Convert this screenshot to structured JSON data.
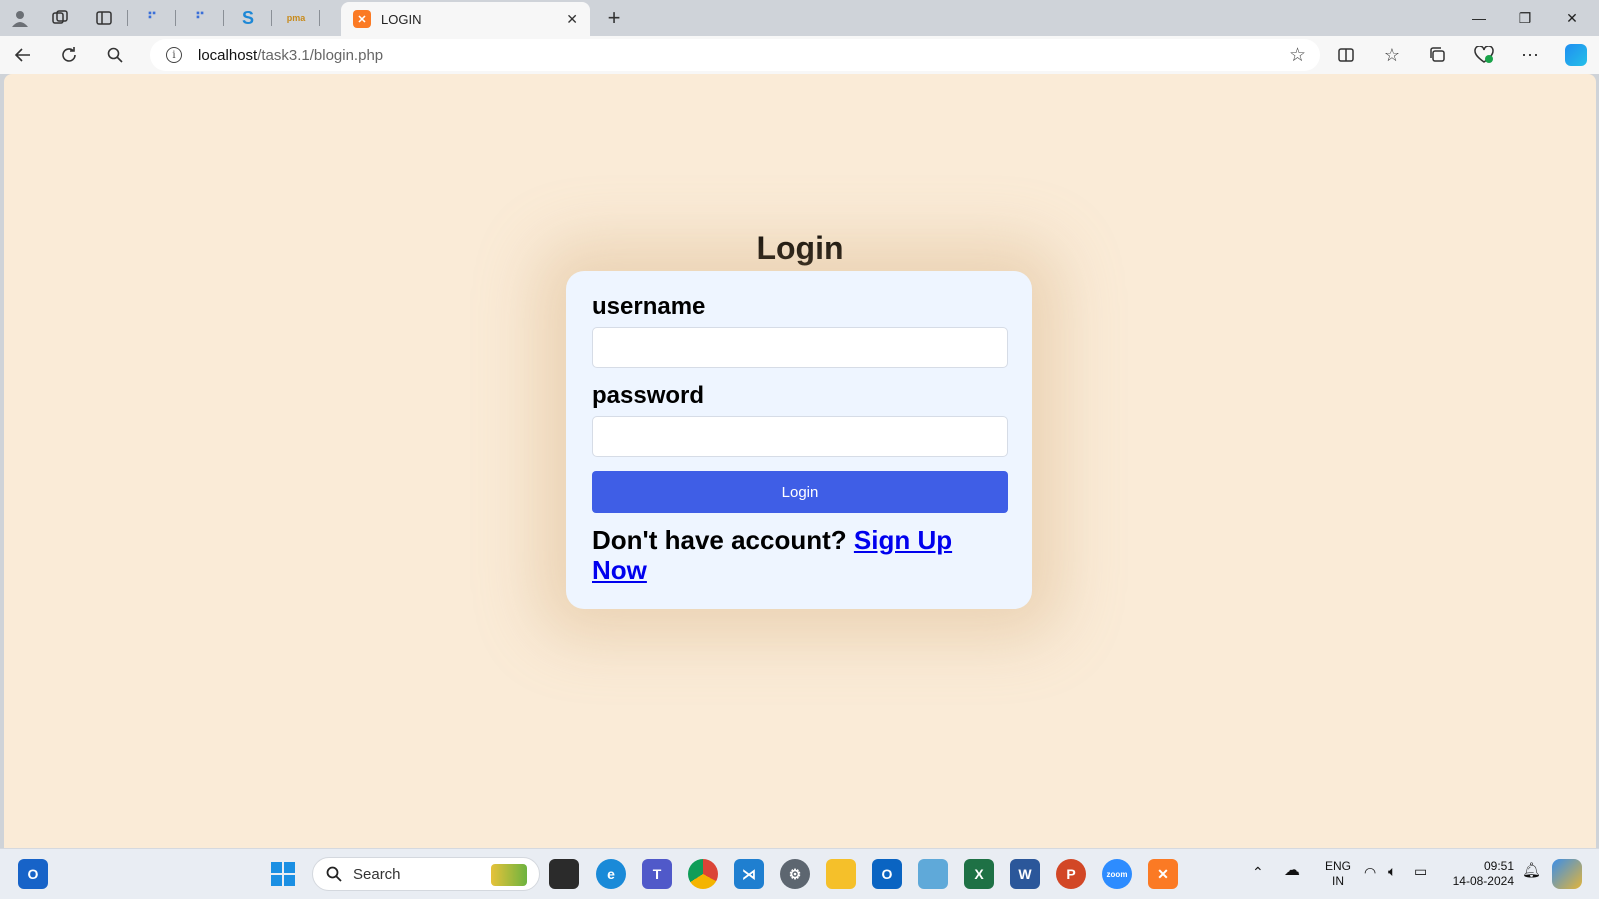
{
  "browser": {
    "tab": {
      "title": "LOGIN",
      "favicon": "xampp-icon"
    },
    "pinned_tabs": [
      "pinned-tab-icon",
      "pinned-tab-icon",
      "skype-icon",
      "pma-icon"
    ],
    "address": {
      "host": "localhost",
      "path": "/task3.1/blogin.php"
    }
  },
  "page": {
    "background": "#faebd7",
    "title": "Login",
    "username_label": "username",
    "username_value": "",
    "password_label": "password",
    "password_value": "",
    "login_button": "Login",
    "signup_prompt": "Don't have account?",
    "signup_link": "Sign Up Now",
    "accent": "#3f5ee6",
    "link_color": "#0000ee"
  },
  "taskbar": {
    "search_placeholder": "Search",
    "lang_top": "ENG",
    "lang_bottom": "IN",
    "time": "09:51",
    "date": "14-08-2024"
  }
}
